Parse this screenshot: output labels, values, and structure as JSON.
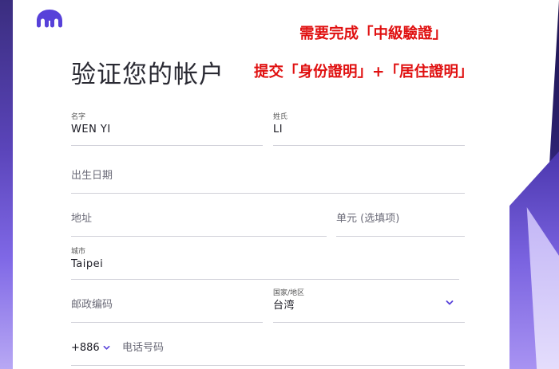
{
  "header": {
    "title": "验证您的帐户"
  },
  "annotations": {
    "line1": "需要完成「中級驗證」",
    "line2": "提交「身份證明」+「居住證明」",
    "color": "#e01010"
  },
  "form": {
    "first_name": {
      "label": "名字",
      "value": "WEN YI"
    },
    "last_name": {
      "label": "姓氏",
      "value": "LI"
    },
    "dob": {
      "placeholder": "出生日期"
    },
    "address": {
      "placeholder": "地址"
    },
    "unit": {
      "placeholder": "单元 (选填项)"
    },
    "city": {
      "label": "城市",
      "value": "Taipei"
    },
    "postal_code": {
      "placeholder": "邮政编码"
    },
    "country": {
      "label": "国家/地区",
      "value": "台湾"
    },
    "phone": {
      "country_code": "+886",
      "placeholder": "电话号码"
    }
  },
  "icons": {
    "logo": "kraken-logo-icon",
    "country_dropdown": "chevron-down-icon",
    "phone_code_dropdown": "chevron-down-icon"
  },
  "colors": {
    "brand": "#5741d9",
    "accent": "#5741d9",
    "annotation": "#e01010"
  }
}
